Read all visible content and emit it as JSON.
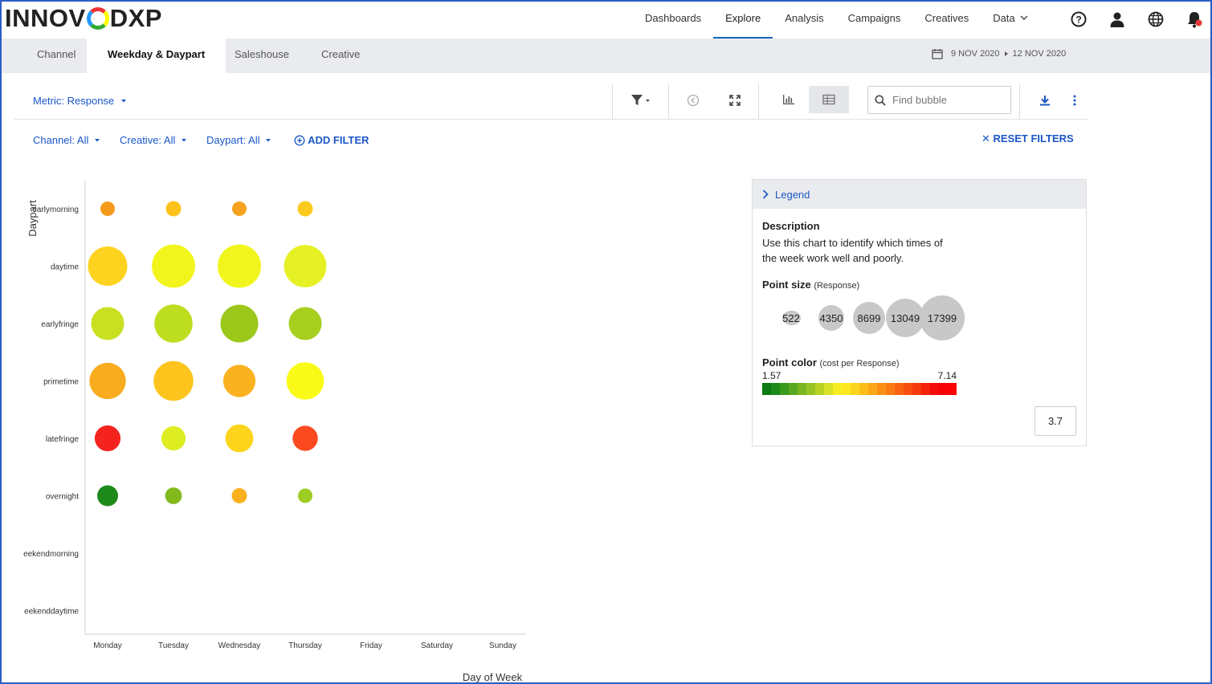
{
  "app": {
    "logo_text": "INNOVIDXP"
  },
  "nav": {
    "items": [
      {
        "label": "Dashboards",
        "active": false
      },
      {
        "label": "Explore",
        "active": true
      },
      {
        "label": "Analysis",
        "active": false
      },
      {
        "label": "Campaigns",
        "active": false
      },
      {
        "label": "Creatives",
        "active": false
      },
      {
        "label": "Data",
        "active": false
      }
    ],
    "icons": [
      "help-icon",
      "user-icon",
      "globe-icon",
      "notification-bell-icon"
    ]
  },
  "tabs": [
    {
      "label": "Channel",
      "active": false
    },
    {
      "label": "Weekday & Daypart",
      "active": true
    },
    {
      "label": "Saleshouse",
      "active": false
    },
    {
      "label": "Creative",
      "active": false
    }
  ],
  "date_range": {
    "start": "9 NOV 2020",
    "end": "12 NOV 2020"
  },
  "toolbar": {
    "metric_label": "Metric: Response",
    "find_placeholder": "Find bubble",
    "icons": [
      "filter-icon",
      "back-icon",
      "expand-icon",
      "bar-chart-icon",
      "table-icon",
      "search-icon",
      "download-icon",
      "more-icon"
    ]
  },
  "filters": {
    "items": [
      "Channel: All",
      "Creative: All",
      "Daypart: All"
    ],
    "add_label": "ADD FILTER",
    "reset_label": "RESET FILTERS"
  },
  "chart_data": {
    "type": "scatter",
    "xlabel": "Day of Week",
    "ylabel": "Daypart",
    "x_categories": [
      "Monday",
      "Tuesday",
      "Wednesday",
      "Thursday",
      "Friday",
      "Saturday",
      "Sunday"
    ],
    "y_categories": [
      "earlymorning",
      "daytime",
      "earlyfringe",
      "primetime",
      "latefringe",
      "overnight",
      "weekendmorning",
      "weekenddaytime"
    ],
    "y_tick_labels": [
      "earlymorning",
      "daytime",
      "earlyfringe",
      "primetime",
      "latefringe",
      "overnight",
      "eekendmorning",
      "eekenddaytime"
    ],
    "size_metric": "Response",
    "color_metric": "cost per Response",
    "color_range": [
      1.57,
      7.14
    ],
    "points": [
      {
        "x": "Monday",
        "y": "earlymorning",
        "response": 1300,
        "color": "#f59a1c"
      },
      {
        "x": "Tuesday",
        "y": "earlymorning",
        "response": 1500,
        "color": "#fcc21b"
      },
      {
        "x": "Wednesday",
        "y": "earlymorning",
        "response": 1100,
        "color": "#f7a321"
      },
      {
        "x": "Thursday",
        "y": "earlymorning",
        "response": 1500,
        "color": "#fcca1e"
      },
      {
        "x": "Monday",
        "y": "daytime",
        "response": 10000,
        "color": "#fdd31f"
      },
      {
        "x": "Tuesday",
        "y": "daytime",
        "response": 12000,
        "color": "#f2f51c"
      },
      {
        "x": "Wednesday",
        "y": "daytime",
        "response": 12100,
        "color": "#f1f51d"
      },
      {
        "x": "Thursday",
        "y": "daytime",
        "response": 11600,
        "color": "#e5f125"
      },
      {
        "x": "Monday",
        "y": "earlyfringe",
        "response": 7000,
        "color": "#c8e01f"
      },
      {
        "x": "Tuesday",
        "y": "earlyfringe",
        "response": 9400,
        "color": "#bddd1f"
      },
      {
        "x": "Wednesday",
        "y": "earlyfringe",
        "response": 9200,
        "color": "#9bc81a"
      },
      {
        "x": "Thursday",
        "y": "earlyfringe",
        "response": 7000,
        "color": "#a6cf1e"
      },
      {
        "x": "Monday",
        "y": "primetime",
        "response": 8500,
        "color": "#f8ac1e"
      },
      {
        "x": "Tuesday",
        "y": "primetime",
        "response": 10100,
        "color": "#fcc41c"
      },
      {
        "x": "Wednesday",
        "y": "primetime",
        "response": 6700,
        "color": "#fbb221"
      },
      {
        "x": "Thursday",
        "y": "primetime",
        "response": 9000,
        "color": "#fafa18"
      },
      {
        "x": "Monday",
        "y": "latefringe",
        "response": 4300,
        "color": "#f5231e"
      },
      {
        "x": "Tuesday",
        "y": "latefringe",
        "response": 3800,
        "color": "#dded22"
      },
      {
        "x": "Wednesday",
        "y": "latefringe",
        "response": 5000,
        "color": "#fcd41c"
      },
      {
        "x": "Thursday",
        "y": "latefringe",
        "response": 4100,
        "color": "#fb4a1f"
      },
      {
        "x": "Monday",
        "y": "overnight",
        "response": 2800,
        "color": "#1f8a1c"
      },
      {
        "x": "Tuesday",
        "y": "overnight",
        "response": 1800,
        "color": "#82b91d"
      },
      {
        "x": "Wednesday",
        "y": "overnight",
        "response": 1500,
        "color": "#f9b01f"
      },
      {
        "x": "Thursday",
        "y": "overnight",
        "response": 1200,
        "color": "#9dcc23"
      }
    ]
  },
  "legend": {
    "header": "Legend",
    "description_title": "Description",
    "description": "Use this chart to identify which times of the week work well and poorly.",
    "point_size_title": "Point size",
    "point_size_sub": "(Response)",
    "size_steps": [
      "522",
      "4350",
      "8699",
      "13049",
      "17399"
    ],
    "point_color_title": "Point color",
    "point_color_sub": "(cost per Response)",
    "color_min": "1.57",
    "color_max": "7.14",
    "color_steps": [
      "#0b7a12",
      "#1e8a18",
      "#3a9a1c",
      "#58a81f",
      "#78b620",
      "#98c422",
      "#b8d323",
      "#d8e124",
      "#f5ee24",
      "#fde81f",
      "#fdd41c",
      "#fcbd19",
      "#fba716",
      "#fa9114",
      "#f97b12",
      "#f86410",
      "#f74e0e",
      "#f6380c",
      "#f5220a",
      "#f40c08",
      "#f70006",
      "#fb0004"
    ],
    "value_box": "3.7"
  }
}
